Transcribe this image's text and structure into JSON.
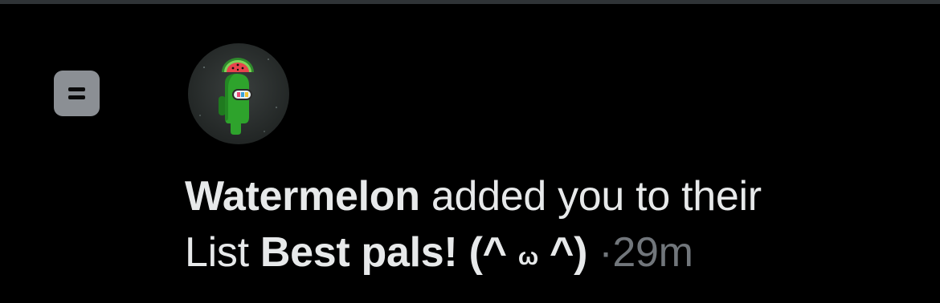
{
  "notification": {
    "type_icon": "list-icon",
    "avatar_icon": "watermelon-crewmate-avatar",
    "user_name": "Watermelon",
    "action_text": "added you to their",
    "list_prefix": "List",
    "list_name": "Best pals!",
    "list_emoticon_open": "(",
    "list_emoticon_left_eye": "^",
    "list_emoticon_mouth": "ω",
    "list_emoticon_right_eye": "^",
    "list_emoticon_close": ")",
    "separator": "·",
    "timestamp": "29m"
  },
  "colors": {
    "background": "#000000",
    "text_primary": "#e7e9ea",
    "text_secondary": "#71767b",
    "list_icon_bg": "#8b8f94",
    "divider": "#2f3336"
  }
}
